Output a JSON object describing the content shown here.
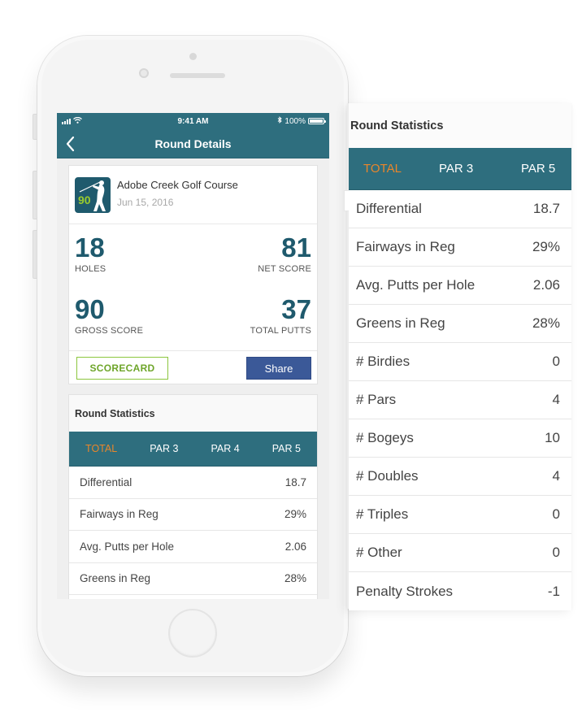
{
  "status_bar": {
    "time": "9:41 AM",
    "battery_text": "100%",
    "battery_level_percent": 100,
    "icons": [
      "signal-icon",
      "wifi-icon",
      "bluetooth-icon",
      "battery-icon"
    ]
  },
  "navbar": {
    "title": "Round Details",
    "back_icon": "chevron-left-icon"
  },
  "round": {
    "course_name": "Adobe Creek Golf Course",
    "date": "Jun 15, 2016",
    "icon_score": "90",
    "icon": "golfer-icon",
    "stats": {
      "holes": {
        "value": "18",
        "label": "HOLES"
      },
      "net_score": {
        "value": "81",
        "label": "NET SCORE"
      },
      "gross_score": {
        "value": "90",
        "label": "GROSS SCORE"
      },
      "total_putts": {
        "value": "37",
        "label": "TOTAL PUTTS"
      }
    },
    "scorecard_label": "SCORECARD",
    "share_label": "Share"
  },
  "round_statistics": {
    "title": "Round Statistics",
    "tabs": [
      "TOTAL",
      "PAR 3",
      "PAR 4",
      "PAR 5"
    ],
    "active_tab": "TOTAL",
    "rows": [
      {
        "label": "Differential",
        "value": "18.7"
      },
      {
        "label": "Fairways in Reg",
        "value": "29%"
      },
      {
        "label": "Avg. Putts per Hole",
        "value": "2.06"
      },
      {
        "label": "Greens in Reg",
        "value": "28%"
      }
    ]
  },
  "expanded_panel": {
    "title": "Round Statistics",
    "tabs": [
      "TOTAL",
      "PAR 3",
      "PAR 5"
    ],
    "active_tab": "TOTAL",
    "rows": [
      {
        "label": "Differential",
        "value": "18.7"
      },
      {
        "label": "Fairways in Reg",
        "value": "29%"
      },
      {
        "label": "Avg. Putts per Hole",
        "value": "2.06"
      },
      {
        "label": "Greens in Reg",
        "value": "28%"
      },
      {
        "label": "# Birdies",
        "value": "0"
      },
      {
        "label": "# Pars",
        "value": "4"
      },
      {
        "label": "# Bogeys",
        "value": "10"
      },
      {
        "label": "# Doubles",
        "value": "4"
      },
      {
        "label": "# Triples",
        "value": "0"
      },
      {
        "label": "# Other",
        "value": "0"
      },
      {
        "label": "Penalty Strokes",
        "value": "-1"
      }
    ]
  },
  "colors": {
    "primary": "#2e6e7e",
    "accent_active_tab": "#e9862b",
    "score_number": "#1f5a6d",
    "scorecard_green": "#8cc63e",
    "share_blue": "#3b5998",
    "icon_score_green": "#9acb2d"
  }
}
